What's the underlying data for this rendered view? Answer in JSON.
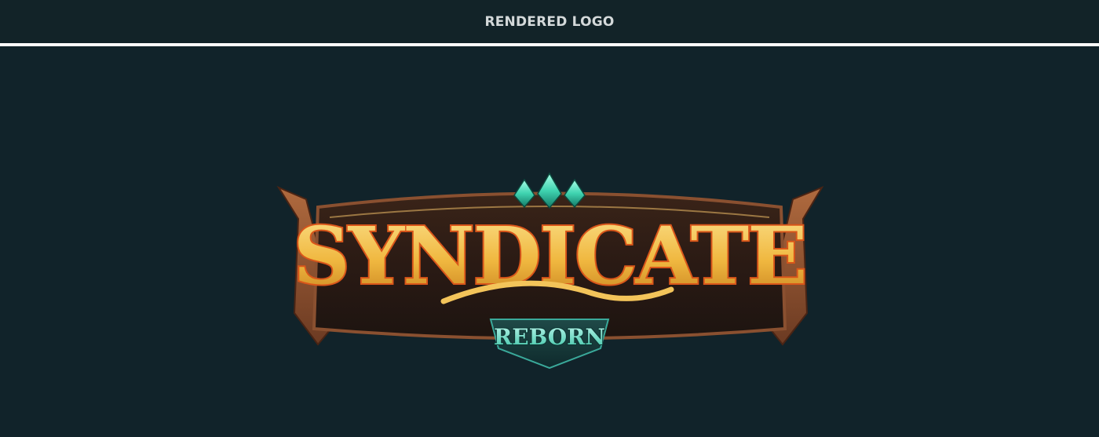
{
  "header": {
    "title": "RENDERED LOGO"
  },
  "logo": {
    "title": "SYNDICATE",
    "subtitle": "REBORN",
    "colors": {
      "background": "#11232a",
      "gold_light": "#f6cf6a",
      "gold_dark": "#c98a22",
      "fire_orange": "#e2581a",
      "frame_brown": "#6b3a22",
      "gem_teal": "#3fd3b0",
      "subtitle_teal": "#8fe6d6"
    }
  }
}
